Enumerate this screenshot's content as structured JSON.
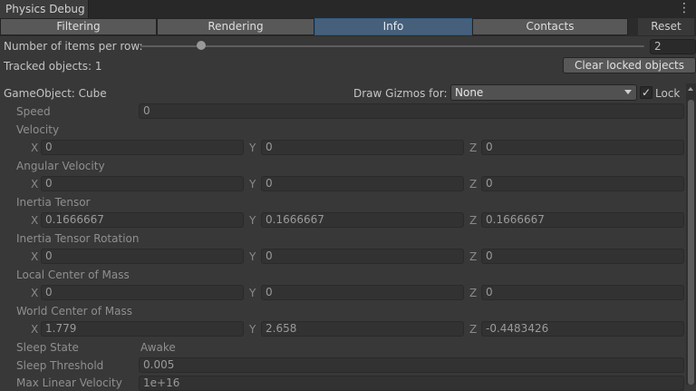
{
  "window": {
    "title": "Physics Debug",
    "menu_icon": "more-vertical-icon",
    "menu_glyph": "⋮"
  },
  "tabs": [
    "Filtering",
    "Rendering",
    "Info",
    "Contacts"
  ],
  "active_tab": "Info",
  "reset_label": "Reset",
  "items_per_row": {
    "label": "Number of items per row:",
    "value": "2",
    "slider_fraction": 0.12
  },
  "tracked_objects": {
    "label": "Tracked objects: 1"
  },
  "clear_button": "Clear locked  objects",
  "gameobject": {
    "label": "GameObject: Cube",
    "draw_gizmos_label": "Draw Gizmos for:",
    "draw_gizmos_value": "None",
    "lock_label": "Lock",
    "lock_checked": "✓"
  },
  "axes": {
    "x": "X",
    "y": "Y",
    "z": "Z"
  },
  "speed": {
    "label": "Speed",
    "value": "0"
  },
  "velocity": {
    "label": "Velocity",
    "x": "0",
    "y": "0",
    "z": "0"
  },
  "angular_velocity": {
    "label": "Angular Velocity",
    "x": "0",
    "y": "0",
    "z": "0"
  },
  "inertia_tensor": {
    "label": "Inertia Tensor",
    "x": "0.1666667",
    "y": "0.1666667",
    "z": "0.1666667"
  },
  "inertia_tensor_rotation": {
    "label": "Inertia Tensor Rotation",
    "x": "0",
    "y": "0",
    "z": "0"
  },
  "local_center_of_mass": {
    "label": "Local Center of Mass",
    "x": "0",
    "y": "0",
    "z": "0"
  },
  "world_center_of_mass": {
    "label": "World Center of Mass",
    "x": "1.779",
    "y": "2.658",
    "z": "-0.4483426"
  },
  "sleep_state": {
    "label": "Sleep State",
    "value": "Awake"
  },
  "sleep_threshold": {
    "label": "Sleep Threshold",
    "value": "0.005"
  },
  "max_linear_velocity": {
    "label": "Max Linear Velocity",
    "value": "1e+16"
  },
  "colors": {
    "active_tab": "#46607c",
    "background": "#383838",
    "field": "#2a2a2a"
  }
}
